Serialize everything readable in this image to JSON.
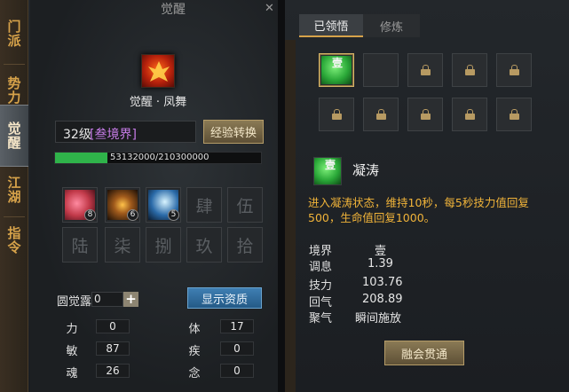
{
  "left_panel": {
    "title": "觉醒",
    "side_tabs": [
      "门派",
      "势力",
      "觉醒",
      "江湖",
      "指令"
    ],
    "active_tab": "觉醒",
    "skill_name": "觉醒 · 凤舞",
    "level": "32级",
    "realm": "[叁境界]",
    "exp_button": "经验转换",
    "exp": {
      "current": 53132000,
      "max": 210300000,
      "text": "53132000/210300000",
      "fill_fraction": 0.253
    },
    "slots_row1": [
      {
        "kind": "skill",
        "level": "8",
        "color": "#c23a4a"
      },
      {
        "kind": "skill",
        "level": "6",
        "color": "#a05a1c"
      },
      {
        "kind": "skill",
        "level": "5",
        "color": "#2a6aa8"
      },
      {
        "kind": "locked",
        "glyph": "肆"
      },
      {
        "kind": "locked",
        "glyph": "伍"
      }
    ],
    "slots_row2": [
      {
        "kind": "locked",
        "glyph": "陆"
      },
      {
        "kind": "locked",
        "glyph": "柒"
      },
      {
        "kind": "locked",
        "glyph": "捌"
      },
      {
        "kind": "locked",
        "glyph": "玖"
      },
      {
        "kind": "locked",
        "glyph": "拾"
      }
    ],
    "dew_label": "圆觉露",
    "dew_value": "0",
    "show_button": "显示资质",
    "stats": {
      "li": {
        "label": "力",
        "value": "0"
      },
      "ti": {
        "label": "体",
        "value": "17"
      },
      "min": {
        "label": "敏",
        "value": "87"
      },
      "ji": {
        "label": "疾",
        "value": "0"
      },
      "hun": {
        "label": "魂",
        "value": "26"
      },
      "nian": {
        "label": "念",
        "value": "0"
      }
    }
  },
  "right_panel": {
    "tabs": [
      "已领悟",
      "修炼"
    ],
    "active_tab": "已领悟",
    "first_slot_glyph": "壹",
    "skill_name": "凝涛",
    "skill_glyph": "壹",
    "description": "进入凝涛状态，维持10秒，每5秒技力值回复500，生命值回复1000。",
    "info": [
      {
        "label": "境界",
        "value": "壹"
      },
      {
        "label": "调息",
        "value": "1.39"
      },
      {
        "label": "技力",
        "value": "103.76"
      },
      {
        "label": "回气",
        "value": "208.89"
      },
      {
        "label": "聚气",
        "value": "瞬间施放"
      }
    ],
    "merge_button": "融会贯通"
  },
  "icons": {
    "close": "close-icon",
    "lock": "lock-icon",
    "plus": "plus-icon"
  }
}
